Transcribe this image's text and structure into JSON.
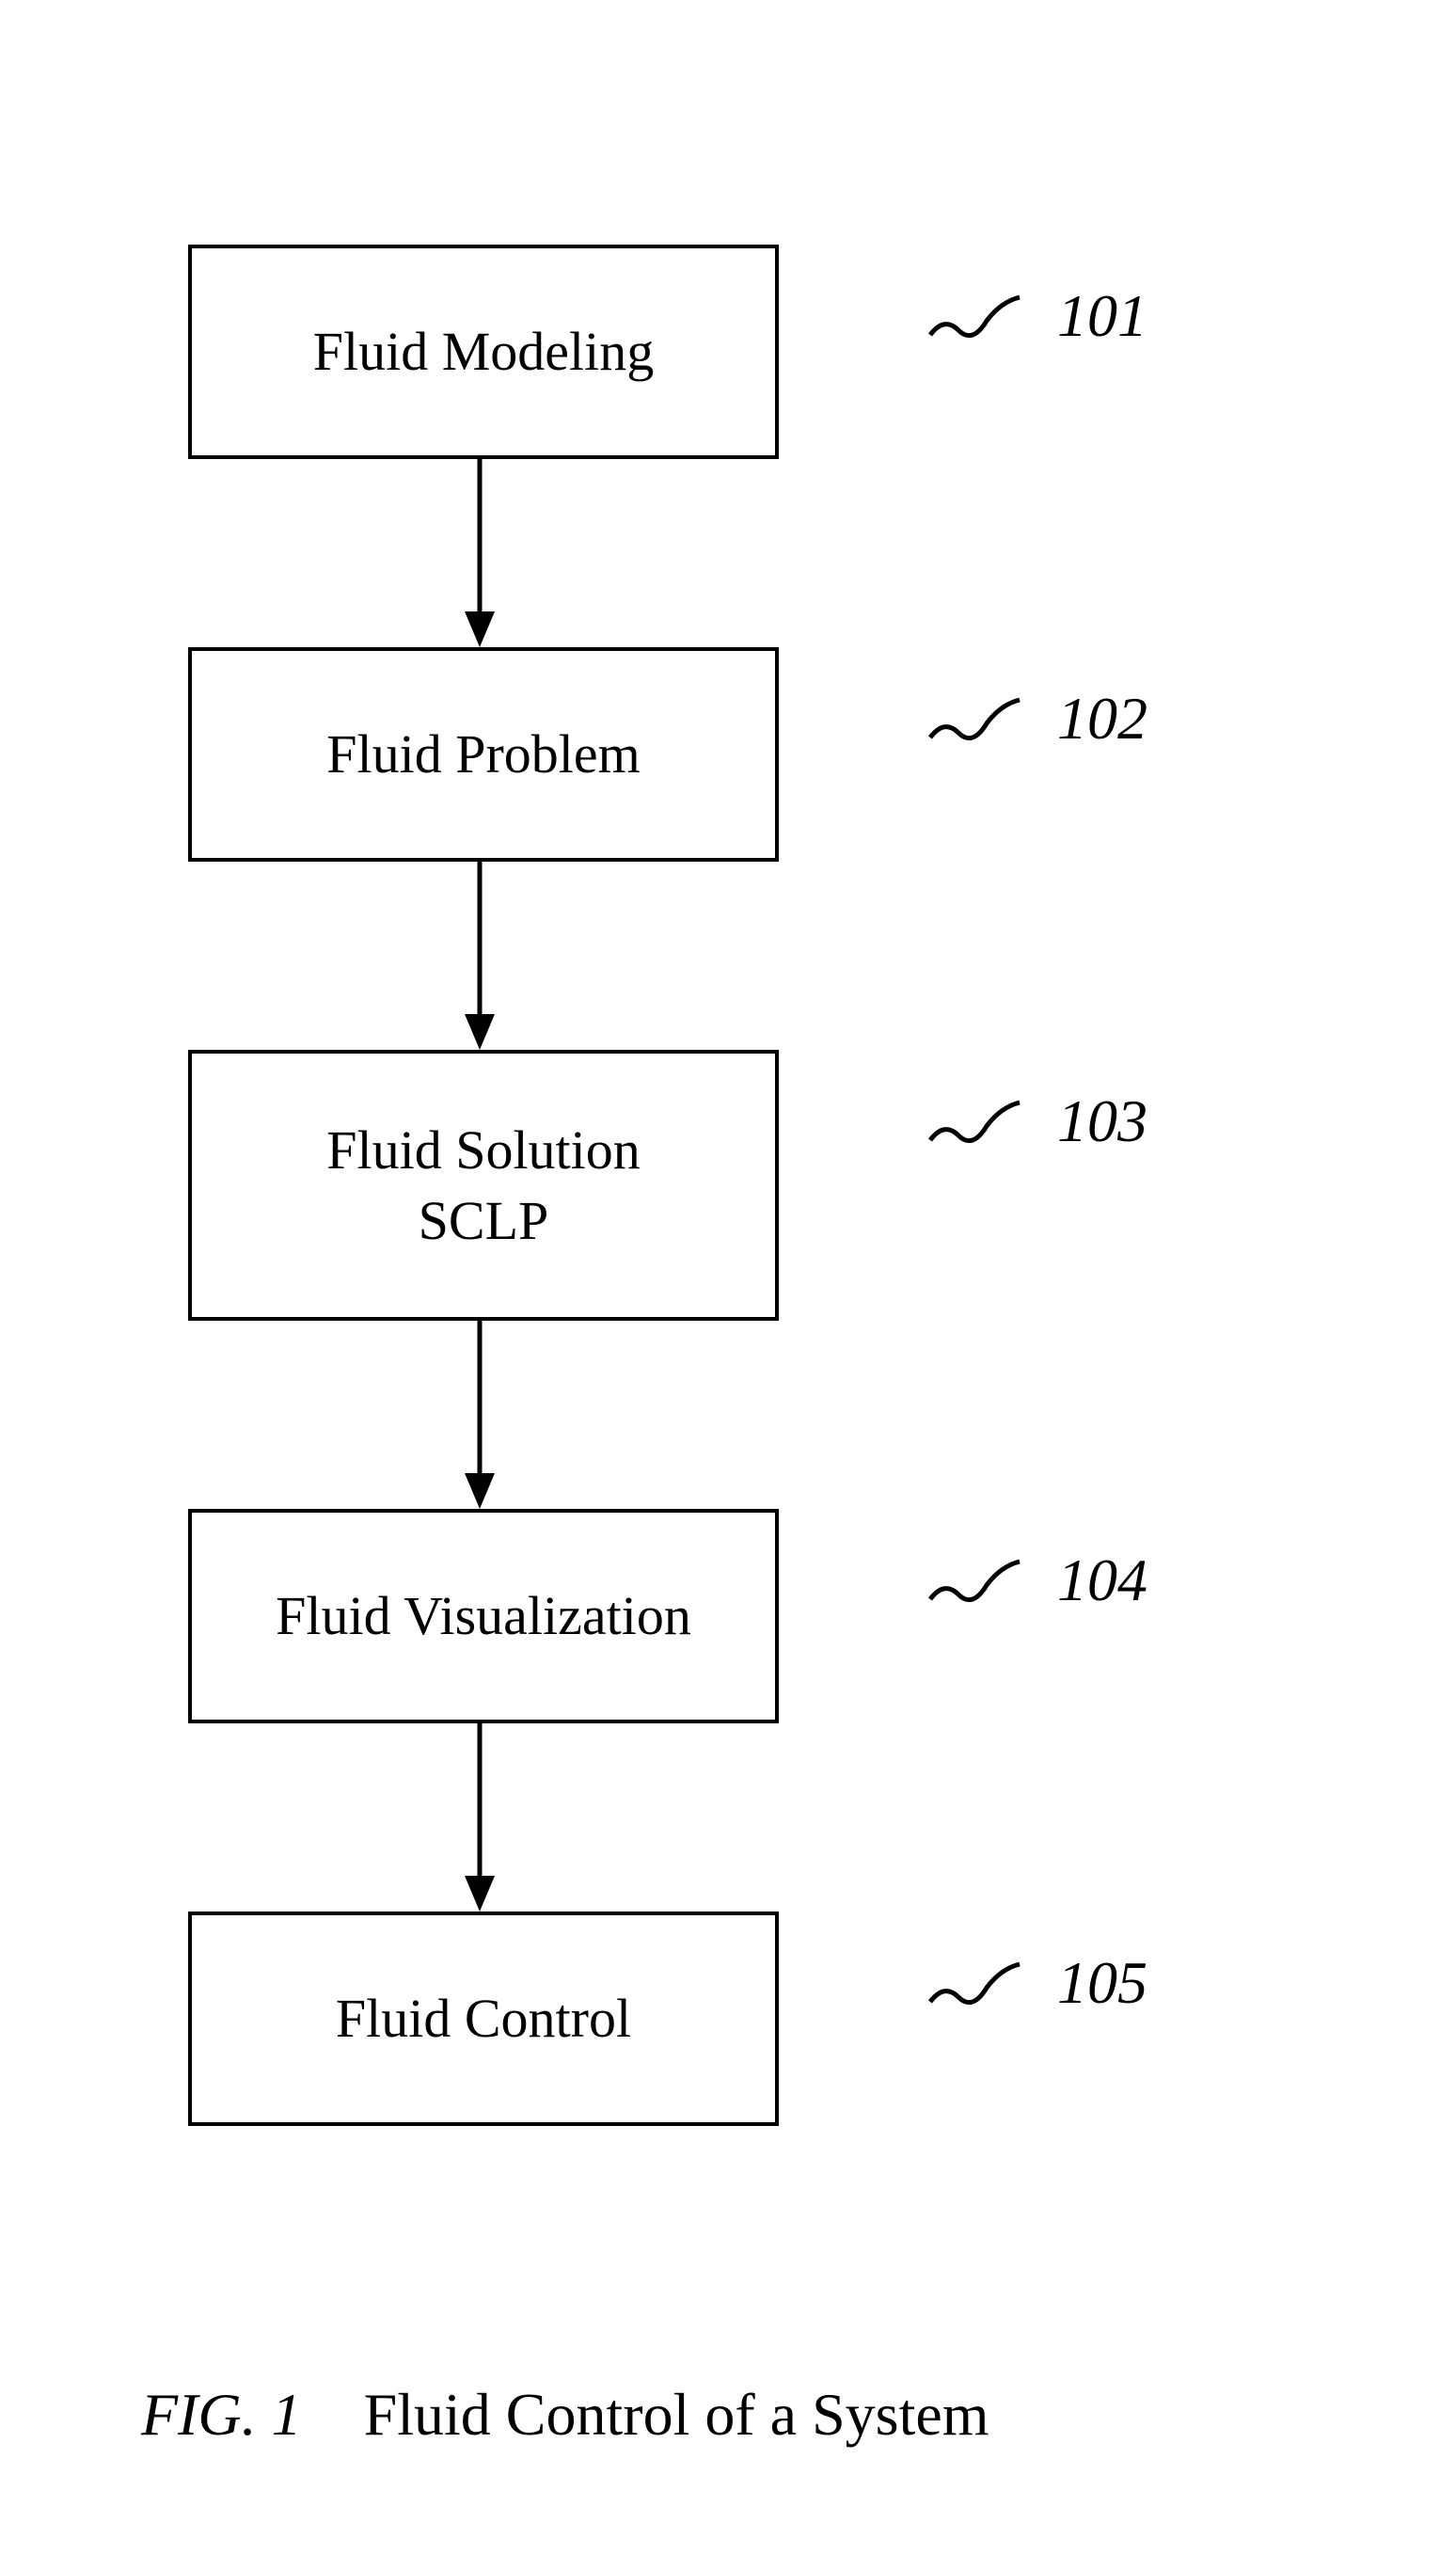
{
  "boxes": [
    {
      "line1": "Fluid Modeling",
      "line2": "",
      "ref": "101"
    },
    {
      "line1": "Fluid Problem",
      "line2": "",
      "ref": "102"
    },
    {
      "line1": "Fluid Solution",
      "line2": "SCLP",
      "ref": "103"
    },
    {
      "line1": "Fluid Visualization",
      "line2": "",
      "ref": "104"
    },
    {
      "line1": "Fluid Control",
      "line2": "",
      "ref": "105"
    }
  ],
  "caption": {
    "figLabel": "FIG. 1",
    "text": "Fluid Control of a System"
  }
}
